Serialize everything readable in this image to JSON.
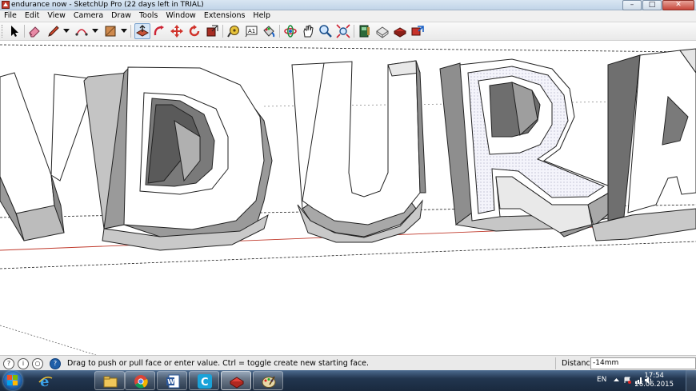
{
  "window": {
    "title": "endurance now - SketchUp Pro (22 days left in TRIAL)",
    "controls": [
      "minimize",
      "maximize",
      "close"
    ]
  },
  "menu": [
    "File",
    "Edit",
    "View",
    "Camera",
    "Draw",
    "Tools",
    "Window",
    "Extensions",
    "Help"
  ],
  "toolbar": {
    "tools": [
      {
        "name": "select-icon"
      },
      {
        "name": "eraser-icon"
      },
      {
        "name": "pencil-icon",
        "dropdown": true
      },
      {
        "name": "arc-icon",
        "dropdown": true
      },
      {
        "name": "rectangle-icon",
        "dropdown": true
      },
      {
        "name": "push-pull-icon",
        "active": true
      },
      {
        "name": "follow-me-icon"
      },
      {
        "name": "move-icon"
      },
      {
        "name": "rotate-icon"
      },
      {
        "name": "scale-icon"
      },
      {
        "name": "tape-measure-icon"
      },
      {
        "name": "text-icon"
      },
      {
        "name": "paint-bucket-icon"
      },
      {
        "name": "orbit-icon"
      },
      {
        "name": "pan-icon"
      },
      {
        "name": "zoom-icon"
      },
      {
        "name": "zoom-extents-icon"
      },
      {
        "name": "components-icon"
      },
      {
        "name": "3d-warehouse-icon"
      },
      {
        "name": "extension-warehouse-icon"
      },
      {
        "name": "share-model-icon"
      }
    ]
  },
  "viewport": {
    "letters": [
      "N",
      "D",
      "U",
      "R",
      "A"
    ],
    "red_axis_color": "#c0392b"
  },
  "status": {
    "hint": "Drag to push or pull face or enter value.  Ctrl = toggle create new starting face.",
    "vcb_label": "Distance",
    "vcb_value": "-14mm"
  },
  "taskbar": {
    "apps": [
      {
        "name": "internet-explorer-icon",
        "state": "pinned"
      },
      {
        "name": "file-explorer-icon",
        "state": "open"
      },
      {
        "name": "chrome-icon",
        "state": "open"
      },
      {
        "name": "word-icon",
        "state": "open"
      },
      {
        "name": "c-app-icon",
        "state": "open"
      },
      {
        "name": "sketchup-icon",
        "state": "active"
      },
      {
        "name": "paint-icon",
        "state": "open"
      }
    ],
    "language": "EN",
    "time": "17:54",
    "date": "26.06.2015"
  }
}
